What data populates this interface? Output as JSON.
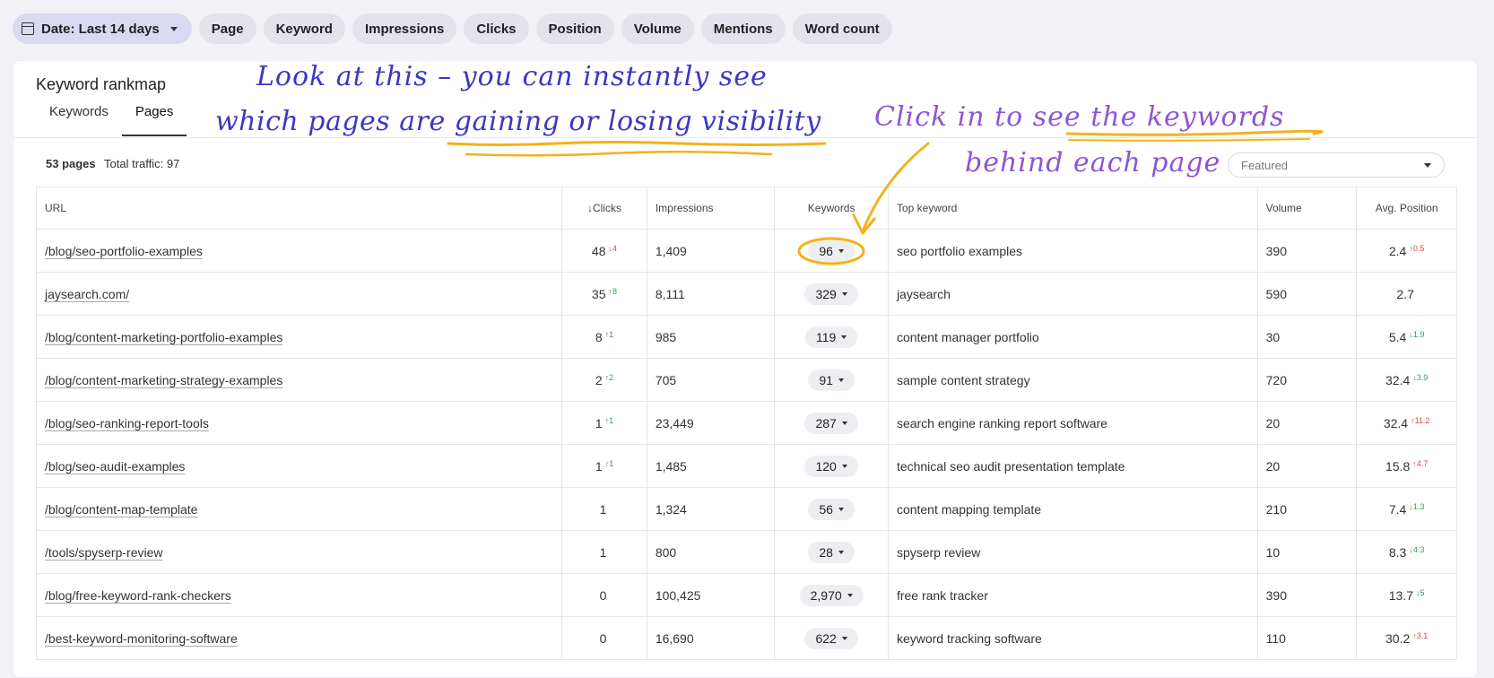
{
  "filters": {
    "date_label": "Date: Last 14 days",
    "chips": [
      "Page",
      "Keyword",
      "Impressions",
      "Clicks",
      "Position",
      "Volume",
      "Mentions",
      "Word count"
    ]
  },
  "card": {
    "title": "Keyword rankmap",
    "tabs": [
      "Keywords",
      "Pages"
    ],
    "active_tab": "Pages",
    "summary_count": "53 pages",
    "summary_traffic": "Total traffic: 97",
    "sort_value": "Featured"
  },
  "table": {
    "headers": {
      "url": "URL",
      "clicks": "↓Clicks",
      "impressions": "Impressions",
      "keywords": "Keywords",
      "top_keyword": "Top keyword",
      "volume": "Volume",
      "avg_position": "Avg. Position"
    },
    "rows": [
      {
        "url": "/blog/seo-portfolio-examples",
        "clicks": "48",
        "clicks_delta": "↓4",
        "impressions": "1,409",
        "keywords": "96",
        "top_keyword": "seo portfolio examples",
        "volume": "390",
        "position": "2.4",
        "position_delta": "↑0.5"
      },
      {
        "url": "jaysearch.com/",
        "clicks": "35",
        "clicks_delta": "↑8",
        "impressions": "8,111",
        "keywords": "329",
        "top_keyword": "jaysearch",
        "volume": "590",
        "position": "2.7",
        "position_delta": ""
      },
      {
        "url": "/blog/content-marketing-portfolio-examples",
        "clicks": "8",
        "clicks_delta": "↑1",
        "impressions": "985",
        "keywords": "119",
        "top_keyword": "content manager portfolio",
        "volume": "30",
        "position": "5.4",
        "position_delta": "↓1.9"
      },
      {
        "url": "/blog/content-marketing-strategy-examples",
        "clicks": "2",
        "clicks_delta": "↑2",
        "impressions": "705",
        "keywords": "91",
        "top_keyword": "sample content strategy",
        "volume": "720",
        "position": "32.4",
        "position_delta": "↓3.9"
      },
      {
        "url": "/blog/seo-ranking-report-tools",
        "clicks": "1",
        "clicks_delta": "↑1",
        "impressions": "23,449",
        "keywords": "287",
        "top_keyword": "search engine ranking report software",
        "volume": "20",
        "position": "32.4",
        "position_delta": "↑11.2"
      },
      {
        "url": "/blog/seo-audit-examples",
        "clicks": "1",
        "clicks_delta": "↑1",
        "impressions": "1,485",
        "keywords": "120",
        "top_keyword": "technical seo audit presentation template",
        "volume": "20",
        "position": "15.8",
        "position_delta": "↑4.7"
      },
      {
        "url": "/blog/content-map-template",
        "clicks": "1",
        "clicks_delta": "",
        "impressions": "1,324",
        "keywords": "56",
        "top_keyword": "content mapping template",
        "volume": "210",
        "position": "7.4",
        "position_delta": "↓1.3"
      },
      {
        "url": "/tools/spyserp-review",
        "clicks": "1",
        "clicks_delta": "",
        "impressions": "800",
        "keywords": "28",
        "top_keyword": "spyserp review",
        "volume": "10",
        "position": "8.3",
        "position_delta": "↓4.3"
      },
      {
        "url": "/blog/free-keyword-rank-checkers",
        "clicks": "0",
        "clicks_delta": "",
        "impressions": "100,425",
        "keywords": "2,970",
        "top_keyword": "free rank tracker",
        "volume": "390",
        "position": "13.7",
        "position_delta": "↓5"
      },
      {
        "url": "/best-keyword-monitoring-software",
        "clicks": "0",
        "clicks_delta": "",
        "impressions": "16,690",
        "keywords": "622",
        "top_keyword": "keyword tracking software",
        "volume": "110",
        "position": "30.2",
        "position_delta": "↑3.1"
      }
    ]
  },
  "annotations": {
    "line1": "Look at this – you can instantly see",
    "line2": "which pages are gaining or losing visibility",
    "line3": "Click in to see the keywords",
    "line4": "behind each page",
    "blue_color": "#3a37c6",
    "purple_color": "#8f54d6",
    "highlight_color": "#f3b21b"
  }
}
